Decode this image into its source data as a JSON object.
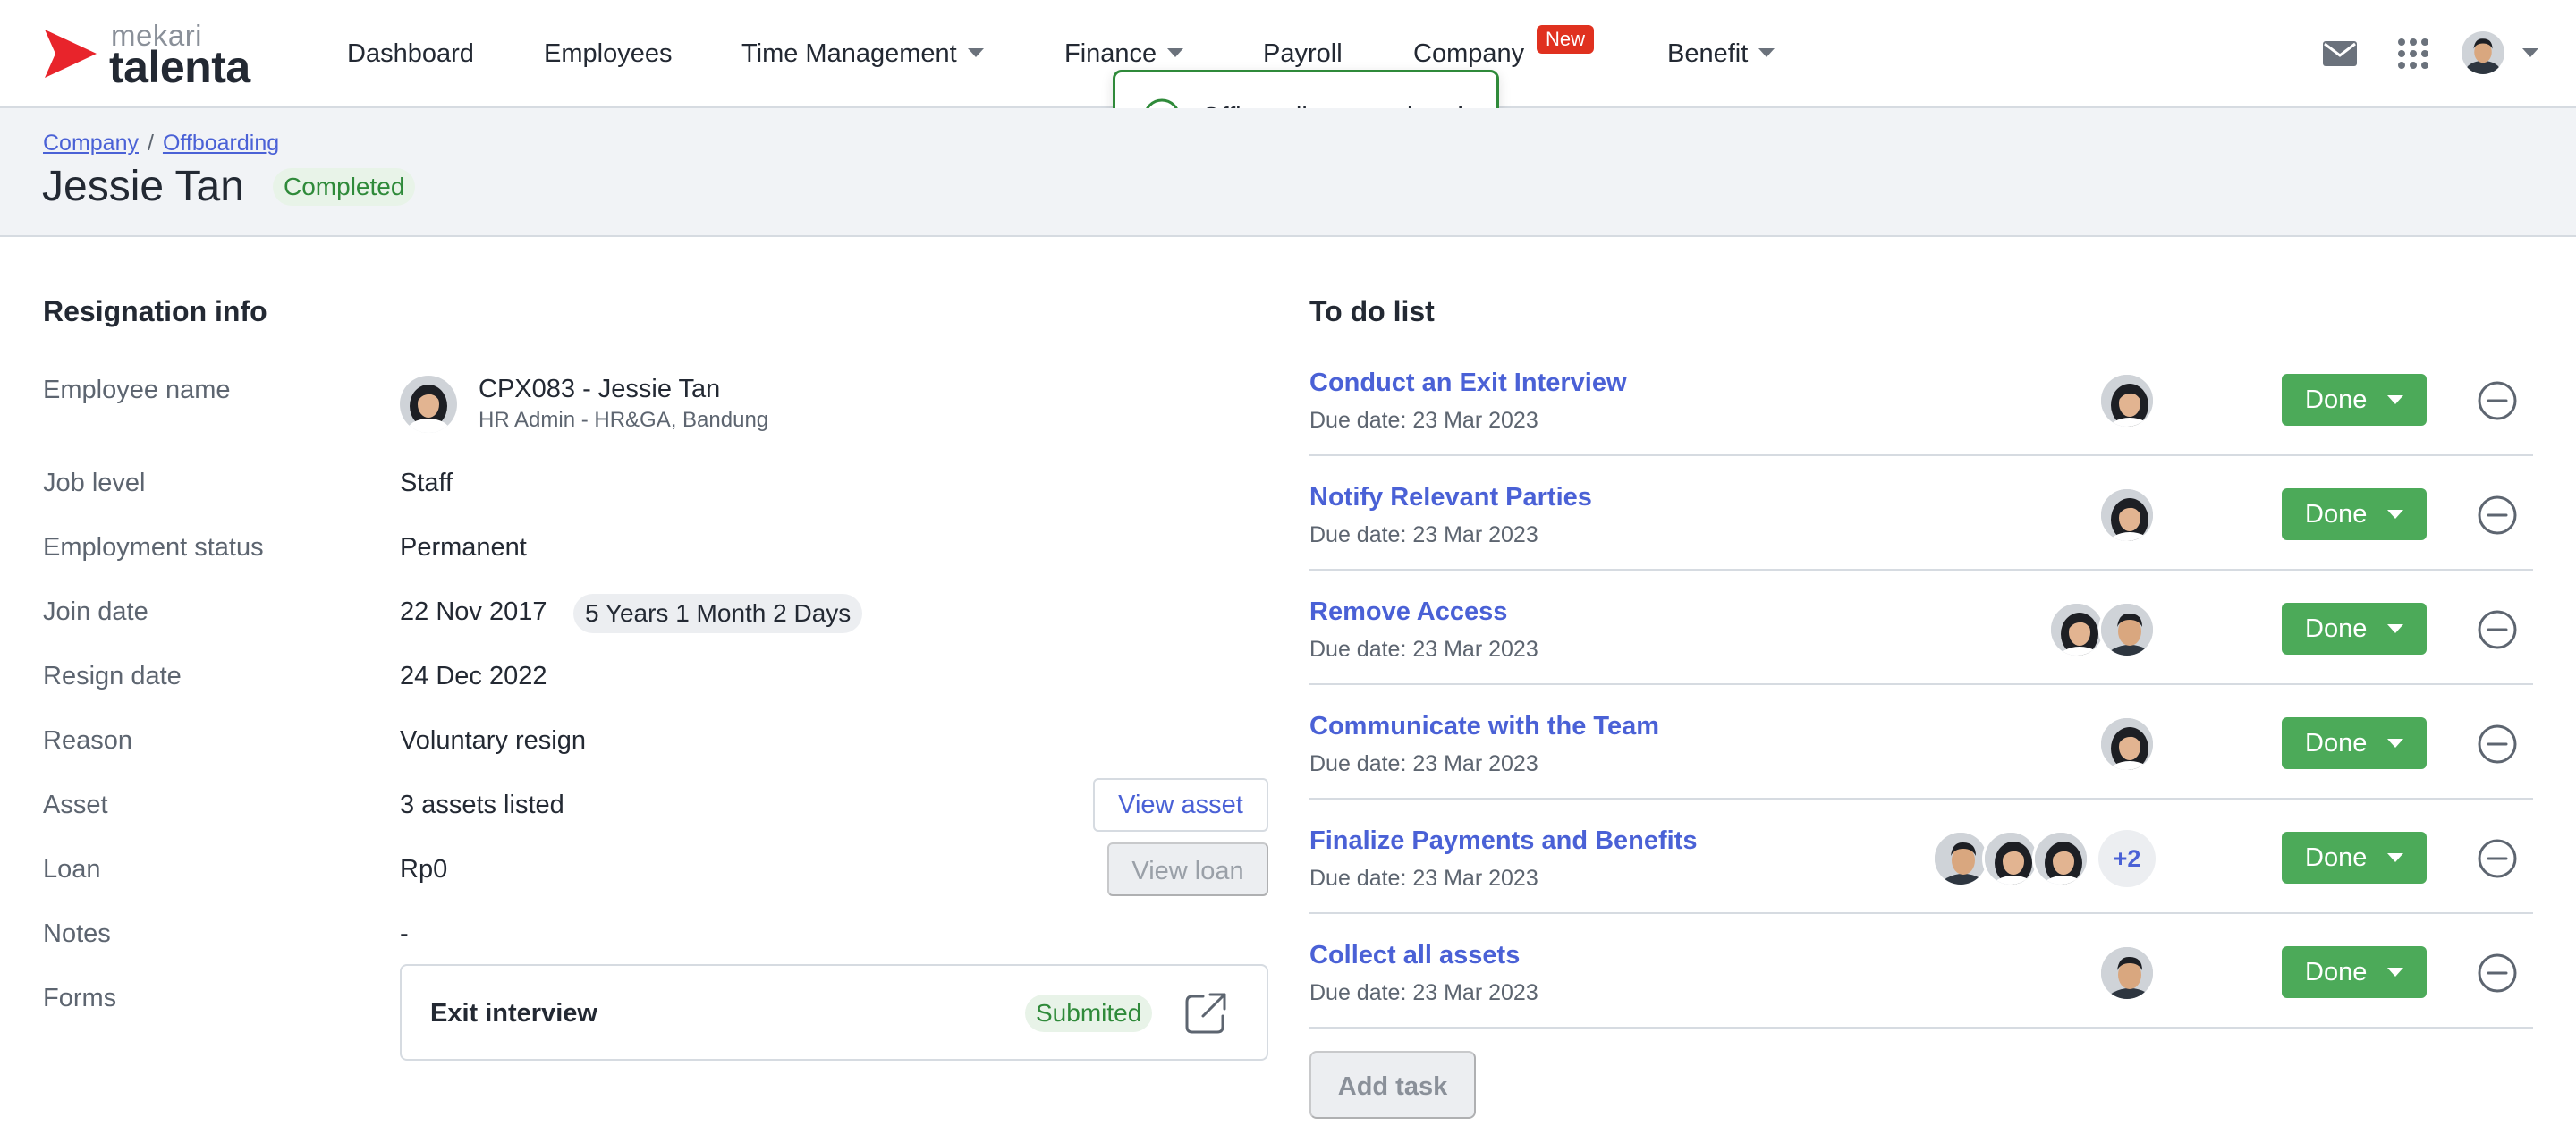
{
  "brand": {
    "small": "mekari",
    "big": "talenta",
    "accent": "#e8242b"
  },
  "nav": {
    "items": [
      {
        "label": "Dashboard",
        "has_dropdown": false
      },
      {
        "label": "Employees",
        "has_dropdown": false
      },
      {
        "label": "Time Management",
        "has_dropdown": true
      },
      {
        "label": "Finance",
        "has_dropdown": true
      },
      {
        "label": "Payroll",
        "has_dropdown": false
      },
      {
        "label": "Company",
        "has_dropdown": false
      },
      {
        "label": "Benefit",
        "has_dropdown": true
      }
    ],
    "company_badge": "New",
    "icons": [
      "mail-icon",
      "apps-grid-icon",
      "user-avatar"
    ]
  },
  "toast": {
    "message": "Offboarding completed",
    "icon": "check-circle-icon",
    "color": "#2f8a3a"
  },
  "header": {
    "breadcrumb": [
      "Company",
      "Offboarding"
    ],
    "title": "Jessie Tan",
    "status": "Completed"
  },
  "resignation": {
    "section_title": "Resignation info",
    "labels": {
      "employee_name": "Employee name",
      "job_level": "Job level",
      "employment_status": "Employment status",
      "join_date": "Join date",
      "resign_date": "Resign date",
      "reason": "Reason",
      "asset": "Asset",
      "loan": "Loan",
      "notes": "Notes",
      "forms": "Forms"
    },
    "employee": {
      "name": "CPX083 - Jessie Tan",
      "subtitle": "HR Admin - HR&GA, Bandung"
    },
    "job_level": "Staff",
    "employment_status": "Permanent",
    "join_date": "22 Nov 2017",
    "tenure": "5 Years 1 Month 2 Days",
    "resign_date": "24 Dec 2022",
    "reason": "Voluntary resign",
    "asset": "3 assets listed",
    "view_asset_label": "View asset",
    "loan": "Rp0",
    "view_loan_label": "View loan",
    "notes": "-",
    "form": {
      "name": "Exit interview",
      "status": "Submited"
    }
  },
  "todo": {
    "section_title": "To do list",
    "done_label": "Done",
    "add_task_label": "Add task",
    "items": [
      {
        "title": "Conduct an Exit Interview",
        "due": "Due date: 23 Mar 2023",
        "assignees": [
          "f"
        ],
        "more": ""
      },
      {
        "title": "Notify Relevant Parties",
        "due": "Due date: 23 Mar 2023",
        "assignees": [
          "f"
        ],
        "more": ""
      },
      {
        "title": "Remove Access",
        "due": "Due date: 23 Mar 2023",
        "assignees": [
          "f",
          "m"
        ],
        "more": ""
      },
      {
        "title": "Communicate with the Team",
        "due": "Due date: 23 Mar 2023",
        "assignees": [
          "f"
        ],
        "more": ""
      },
      {
        "title": "Finalize Payments and Benefits",
        "due": "Due date: 23 Mar 2023",
        "assignees": [
          "m",
          "f",
          "f"
        ],
        "more": "+2"
      },
      {
        "title": "Collect all assets",
        "due": "Due date: 23 Mar 2023",
        "assignees": [
          "m"
        ],
        "more": ""
      }
    ]
  }
}
